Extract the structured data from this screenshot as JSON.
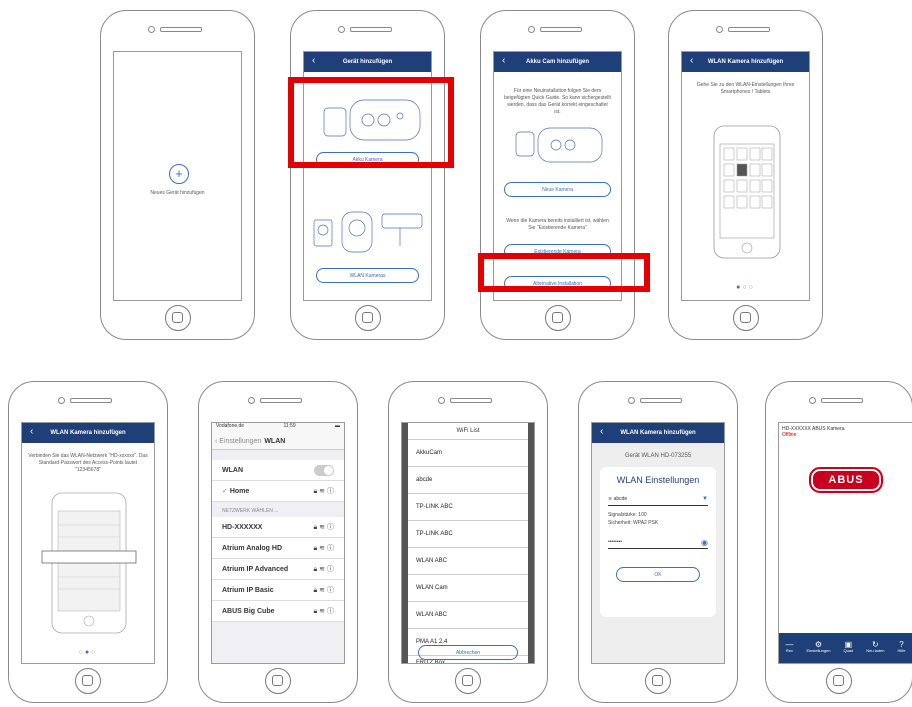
{
  "phones": {
    "p1": {
      "add_label": "Neues Gerät hinzufügen",
      "plus": "+"
    },
    "p2": {
      "header": "Gerät hinzufügen",
      "btn1": "Akku Kamera",
      "btn2": "WLAN Kameras"
    },
    "p3": {
      "header": "Akku Cam hinzufügen",
      "text1": "Für eine Neuinstallation folgen Sie dem beigefügten Quick Guide. So kann sichergestellt werden, dass das Gerät korrekt eingeschaltet ist.",
      "btn_new": "Neue Kamera",
      "text2": "Wenn die Kamera bereits installiert ist, wählen Sie \"Existierende Kamera\"",
      "btn_existing": "Existierende Kamera",
      "btn_alt": "Alternative Installation"
    },
    "p4": {
      "header": "WLAN Kamera hinzufügen",
      "text": "Gehe Sie zu den WLAN-Einstellungen Ihres Smartphones / Tablets"
    },
    "p5": {
      "header": "WLAN Kamera hinzufügen",
      "text": "Verbinden Sie das WLAN-Netzwerk \"HD-xxxxxx\". Das Standard-Passwort des Access-Points lautet \"12345678\""
    },
    "p6": {
      "carrier": "Vodafone.de",
      "time": "11:59",
      "back": "Einstellungen",
      "title": "WLAN",
      "wlan_label": "WLAN",
      "home": "Home",
      "section": "NETZWERK WÄHLEN ...",
      "networks": [
        "HD-XXXXXX",
        "Atrium Analog HD",
        "Atrium IP Advanced",
        "Atrium IP Basic",
        "ABUS Big Cube"
      ]
    },
    "p7": {
      "title": "WiFi List",
      "items": [
        "AkkuCam",
        "abcde",
        "TP-LINK ABC",
        "TP-LINK ABC",
        "WLAN ABC",
        "WLAN Cam",
        "WLAN ABC",
        "PMA A1 2.4",
        "FRITZ Box"
      ],
      "cancel": "Abbrechen"
    },
    "p8": {
      "header": "WLAN Kamera hinzufügen",
      "device": "Gerät WLAN HD-073255",
      "title": "WLAN Einstellungen",
      "ssid": "abcde",
      "signal": "Signalstärke: 100",
      "security": "Sicherheit: WPA2 PSK",
      "password": "••••••••",
      "ok": "OK"
    },
    "p9": {
      "device": "HD-XXXXXX ABUS Kamera",
      "status": "Offline",
      "logo": "ABUS",
      "tabs": [
        "Rec",
        "Einstellungen",
        "Quad",
        "Neu laden",
        "Hilfe"
      ]
    }
  }
}
